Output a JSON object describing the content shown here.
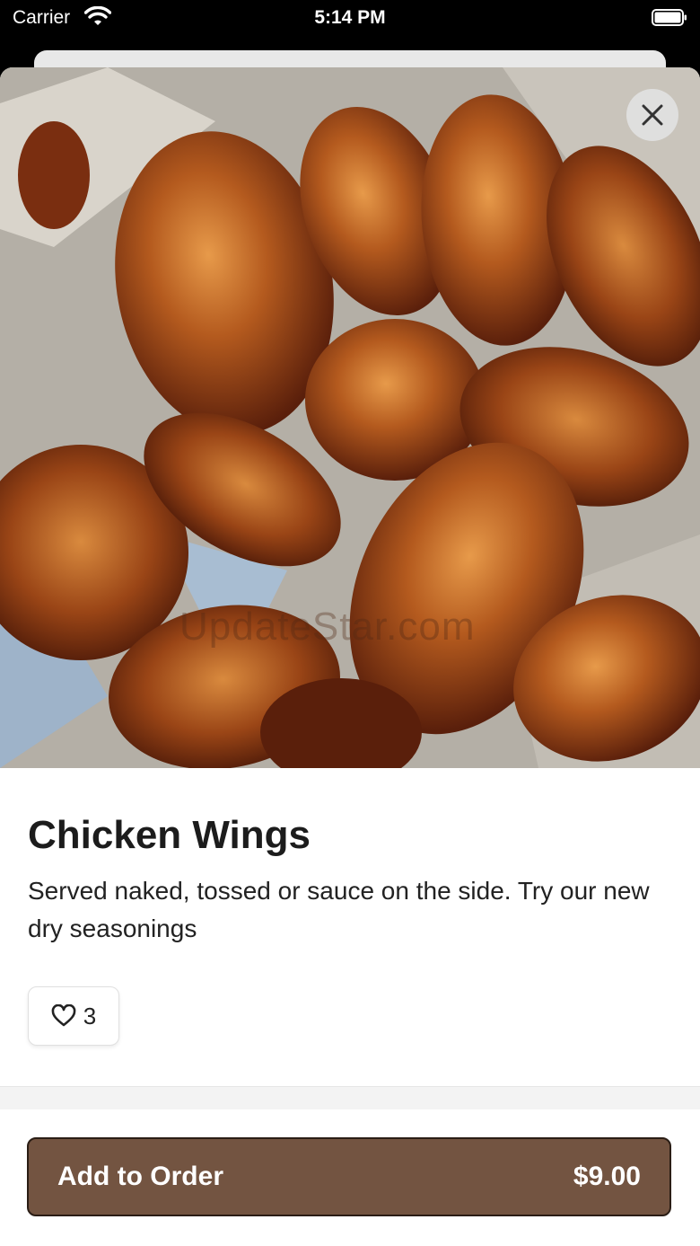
{
  "status_bar": {
    "carrier": "Carrier",
    "time": "5:14 PM"
  },
  "item": {
    "title": "Chicken Wings",
    "description": "Served naked, tossed or sauce on the side. Try our new dry seasonings",
    "likes": "3",
    "watermark": "UpdateStar.com"
  },
  "footer": {
    "add_label": "Add to Order",
    "price": "$9.00"
  },
  "colors": {
    "button": "#735441",
    "button_border": "#2a1d15"
  },
  "icons": {
    "close": "close-icon",
    "like": "heart-outline-icon"
  }
}
